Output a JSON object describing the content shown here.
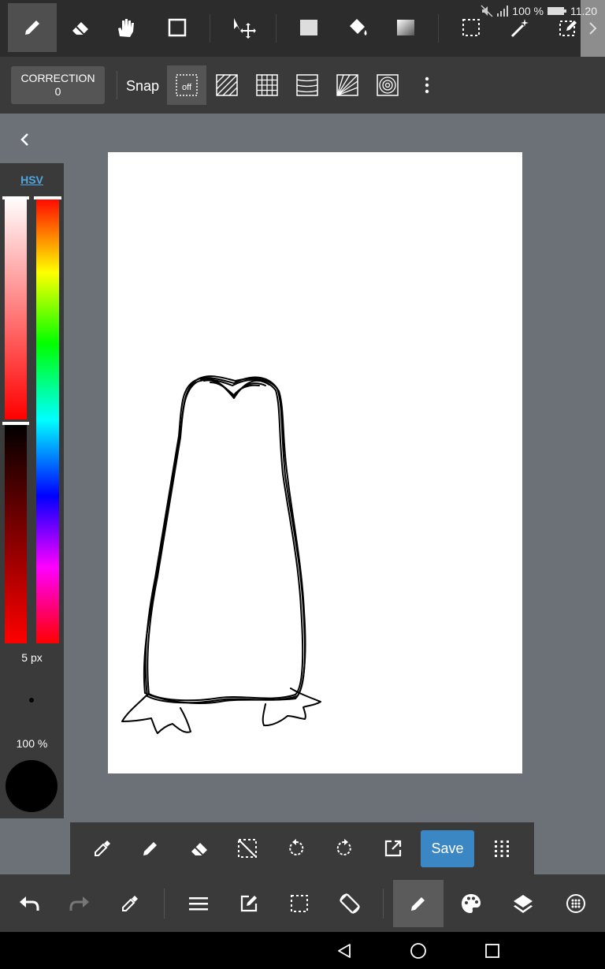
{
  "status_bar": {
    "battery_percent": "100 %",
    "time": "11.20"
  },
  "top_toolbar": {
    "tools": [
      "brush-icon",
      "eraser-icon",
      "hand-icon",
      "rectangle-icon",
      "move-icon",
      "fill-rect-icon",
      "bucket-icon",
      "gradient-icon",
      "select-rect-icon",
      "magic-wand-icon",
      "select-pen-icon"
    ],
    "active_tool": "brush-icon"
  },
  "snap_bar": {
    "correction_label": "CORRECTION",
    "correction_value": "0",
    "snap_label": "Snap",
    "snap_off_label": "off"
  },
  "color_panel": {
    "mode_label": "HSV",
    "brush_size": "5 px",
    "opacity": "100 %",
    "current_color": "#000000"
  },
  "tool_bar": {
    "save_label": "Save"
  },
  "colors": {
    "accent": "#3a87c4",
    "hsv_link": "#4fa8e6"
  }
}
